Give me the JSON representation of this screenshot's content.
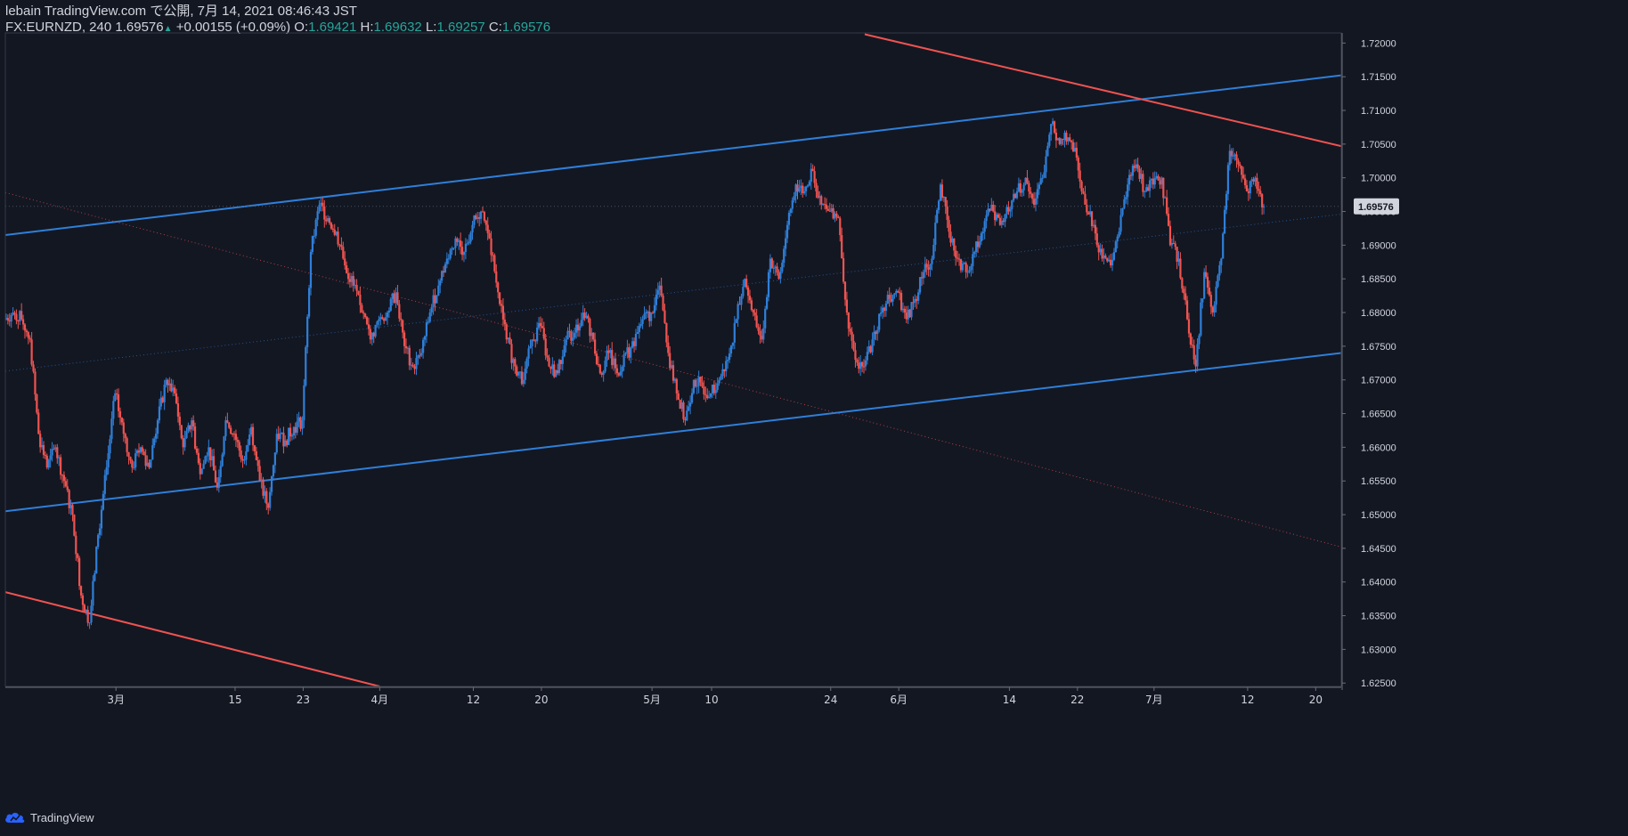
{
  "header": {
    "line1": "lebain TradingView.com で公開, 7月 14, 2021 08:46:43 JST",
    "symbol": "FX:EURNZD, 240",
    "last": "1.69576",
    "change": "+0.00155 (+0.09%)",
    "o_label": "O:",
    "o_value": "1.69421",
    "h_label": "H:",
    "h_value": "1.69632",
    "l_label": "L:",
    "l_value": "1.69257",
    "c_label": "C:",
    "c_value": "1.69576"
  },
  "footer": {
    "brand": "TradingView",
    "logo_icon": "tradingview-cloud-icon"
  },
  "colors": {
    "background": "#131722",
    "up": "#2f7fd8",
    "down": "#ef5350",
    "channel": "#2f7fd8",
    "trend": "#ef5350",
    "axis_text": "#d1d4dc",
    "price_label_bg": "#d1d4dc"
  },
  "chart_data": {
    "type": "candlestick",
    "ylim": [
      1.6245,
      1.7215
    ],
    "y_ticks": [
      "1.72000",
      "1.71500",
      "1.71000",
      "1.70500",
      "1.70000",
      "1.69500",
      "1.69000",
      "1.68500",
      "1.68000",
      "1.67500",
      "1.67000",
      "1.66500",
      "1.66000",
      "1.65500",
      "1.65000",
      "1.64500",
      "1.64000",
      "1.63500",
      "1.63000",
      "1.62500"
    ],
    "x_ticks": [
      {
        "label": "3月",
        "date": "2021-03-01"
      },
      {
        "label": "15",
        "date": "2021-03-15"
      },
      {
        "label": "23",
        "date": "2021-03-23"
      },
      {
        "label": "4月",
        "date": "2021-04-01"
      },
      {
        "label": "12",
        "date": "2021-04-12"
      },
      {
        "label": "20",
        "date": "2021-04-20"
      },
      {
        "label": "5月",
        "date": "2021-05-03"
      },
      {
        "label": "10",
        "date": "2021-05-10"
      },
      {
        "label": "24",
        "date": "2021-05-24"
      },
      {
        "label": "6月",
        "date": "2021-06-01"
      },
      {
        "label": "14",
        "date": "2021-06-14"
      },
      {
        "label": "22",
        "date": "2021-06-22"
      },
      {
        "label": "7月",
        "date": "2021-07-01"
      },
      {
        "label": "12",
        "date": "2021-07-12"
      },
      {
        "label": "20",
        "date": "2021-07-20"
      }
    ],
    "last_price_label": "1.69576",
    "last_price": 1.69576,
    "path_waypoints": [
      [
        "2021-02-16",
        1.679
      ],
      [
        "2021-02-17",
        1.68
      ],
      [
        "2021-02-18",
        1.679
      ],
      [
        "2021-02-19",
        1.676
      ],
      [
        "2021-02-20",
        1.662
      ],
      [
        "2021-02-21",
        1.657
      ],
      [
        "2021-02-22",
        1.66
      ],
      [
        "2021-02-23",
        1.655
      ],
      [
        "2021-02-24",
        1.65
      ],
      [
        "2021-02-25",
        1.638
      ],
      [
        "2021-02-26",
        1.634
      ],
      [
        "2021-02-27",
        1.647
      ],
      [
        "2021-02-28",
        1.657
      ],
      [
        "2021-03-01",
        1.668
      ],
      [
        "2021-03-02",
        1.662
      ],
      [
        "2021-03-03",
        1.657
      ],
      [
        "2021-03-04",
        1.66
      ],
      [
        "2021-03-05",
        1.657
      ],
      [
        "2021-03-06",
        1.664
      ],
      [
        "2021-03-07",
        1.67
      ],
      [
        "2021-03-08",
        1.668
      ],
      [
        "2021-03-09",
        1.66
      ],
      [
        "2021-03-10",
        1.664
      ],
      [
        "2021-03-11",
        1.656
      ],
      [
        "2021-03-12",
        1.66
      ],
      [
        "2021-03-13",
        1.654
      ],
      [
        "2021-03-14",
        1.664
      ],
      [
        "2021-03-15",
        1.662
      ],
      [
        "2021-03-16",
        1.658
      ],
      [
        "2021-03-17",
        1.663
      ],
      [
        "2021-03-18",
        1.655
      ],
      [
        "2021-03-19",
        1.651
      ],
      [
        "2021-03-20",
        1.662
      ],
      [
        "2021-03-21",
        1.661
      ],
      [
        "2021-03-22",
        1.663
      ],
      [
        "2021-03-23",
        1.664
      ],
      [
        "2021-03-24",
        1.689
      ],
      [
        "2021-03-25",
        1.696
      ],
      [
        "2021-03-26",
        1.694
      ],
      [
        "2021-03-27",
        1.692
      ],
      [
        "2021-03-28",
        1.687
      ],
      [
        "2021-03-29",
        1.684
      ],
      [
        "2021-03-30",
        1.68
      ],
      [
        "2021-03-31",
        1.676
      ],
      [
        "2021-04-01",
        1.679
      ],
      [
        "2021-04-02",
        1.68
      ],
      [
        "2021-04-03",
        1.683
      ],
      [
        "2021-04-04",
        1.675
      ],
      [
        "2021-04-05",
        1.672
      ],
      [
        "2021-04-06",
        1.674
      ],
      [
        "2021-04-07",
        1.68
      ],
      [
        "2021-04-08",
        1.684
      ],
      [
        "2021-04-09",
        1.688
      ],
      [
        "2021-04-10",
        1.691
      ],
      [
        "2021-04-11",
        1.689
      ],
      [
        "2021-04-12",
        1.693
      ],
      [
        "2021-04-13",
        1.695
      ],
      [
        "2021-04-14",
        1.691
      ],
      [
        "2021-04-15",
        1.683
      ],
      [
        "2021-04-16",
        1.676
      ],
      [
        "2021-04-17",
        1.672
      ],
      [
        "2021-04-18",
        1.67
      ],
      [
        "2021-04-19",
        1.676
      ],
      [
        "2021-04-20",
        1.678
      ],
      [
        "2021-04-21",
        1.672
      ],
      [
        "2021-04-22",
        1.671
      ],
      [
        "2021-04-23",
        1.676
      ],
      [
        "2021-04-24",
        1.677
      ],
      [
        "2021-04-25",
        1.68
      ],
      [
        "2021-04-26",
        1.677
      ],
      [
        "2021-04-27",
        1.671
      ],
      [
        "2021-04-28",
        1.674
      ],
      [
        "2021-04-29",
        1.671
      ],
      [
        "2021-04-30",
        1.674
      ],
      [
        "2021-05-01",
        1.675
      ],
      [
        "2021-05-02",
        1.679
      ],
      [
        "2021-05-03",
        1.68
      ],
      [
        "2021-05-04",
        1.684
      ],
      [
        "2021-05-05",
        1.674
      ],
      [
        "2021-05-06",
        1.668
      ],
      [
        "2021-05-07",
        1.664
      ],
      [
        "2021-05-08",
        1.67
      ],
      [
        "2021-05-09",
        1.669
      ],
      [
        "2021-05-10",
        1.668
      ],
      [
        "2021-05-11",
        1.67
      ],
      [
        "2021-05-12",
        1.673
      ],
      [
        "2021-05-13",
        1.679
      ],
      [
        "2021-05-14",
        1.685
      ],
      [
        "2021-05-15",
        1.68
      ],
      [
        "2021-05-16",
        1.676
      ],
      [
        "2021-05-17",
        1.688
      ],
      [
        "2021-05-18",
        1.685
      ],
      [
        "2021-05-19",
        1.693
      ],
      [
        "2021-05-20",
        1.699
      ],
      [
        "2021-05-21",
        1.698
      ],
      [
        "2021-05-22",
        1.701
      ],
      [
        "2021-05-23",
        1.696
      ],
      [
        "2021-05-24",
        1.695
      ],
      [
        "2021-05-25",
        1.694
      ],
      [
        "2021-05-26",
        1.68
      ],
      [
        "2021-05-27",
        1.673
      ],
      [
        "2021-05-28",
        1.672
      ],
      [
        "2021-05-29",
        1.676
      ],
      [
        "2021-05-30",
        1.68
      ],
      [
        "2021-05-31",
        1.682
      ],
      [
        "2021-06-01",
        1.683
      ],
      [
        "2021-06-02",
        1.679
      ],
      [
        "2021-06-03",
        1.682
      ],
      [
        "2021-06-04",
        1.686
      ],
      [
        "2021-06-05",
        1.688
      ],
      [
        "2021-06-06",
        1.699
      ],
      [
        "2021-06-07",
        1.692
      ],
      [
        "2021-06-08",
        1.688
      ],
      [
        "2021-06-09",
        1.686
      ],
      [
        "2021-06-10",
        1.689
      ],
      [
        "2021-06-11",
        1.692
      ],
      [
        "2021-06-12",
        1.696
      ],
      [
        "2021-06-13",
        1.693
      ],
      [
        "2021-06-14",
        1.695
      ],
      [
        "2021-06-15",
        1.698
      ],
      [
        "2021-06-16",
        1.7
      ],
      [
        "2021-06-17",
        1.696
      ],
      [
        "2021-06-18",
        1.7
      ],
      [
        "2021-06-19",
        1.708
      ],
      [
        "2021-06-20",
        1.705
      ],
      [
        "2021-06-21",
        1.706
      ],
      [
        "2021-06-22",
        1.703
      ],
      [
        "2021-06-23",
        1.696
      ],
      [
        "2021-06-24",
        1.693
      ],
      [
        "2021-06-25",
        1.688
      ],
      [
        "2021-06-26",
        1.687
      ],
      [
        "2021-06-27",
        1.692
      ],
      [
        "2021-06-28",
        1.699
      ],
      [
        "2021-06-29",
        1.702
      ],
      [
        "2021-06-30",
        1.698
      ],
      [
        "2021-07-01",
        1.699
      ],
      [
        "2021-07-02",
        1.7
      ],
      [
        "2021-07-03",
        1.69
      ],
      [
        "2021-07-04",
        1.688
      ],
      [
        "2021-07-05",
        1.679
      ],
      [
        "2021-07-06",
        1.672
      ],
      [
        "2021-07-07",
        1.686
      ],
      [
        "2021-07-08",
        1.68
      ],
      [
        "2021-07-09",
        1.688
      ],
      [
        "2021-07-10",
        1.704
      ],
      [
        "2021-07-11",
        1.702
      ],
      [
        "2021-07-12",
        1.698
      ],
      [
        "2021-07-13",
        1.7
      ],
      [
        "2021-07-14",
        1.69576
      ]
    ],
    "drawings": [
      {
        "kind": "channel-upper",
        "from": [
          "2021-02-16",
          1.6915
        ],
        "to": [
          "2021-07-23",
          1.7152
        ]
      },
      {
        "kind": "channel-lower",
        "from": [
          "2021-02-16",
          1.6505
        ],
        "to": [
          "2021-07-23",
          1.674
        ]
      },
      {
        "kind": "channel-mid",
        "from": [
          "2021-02-16",
          1.6713
        ],
        "to": [
          "2021-07-23",
          1.6946
        ]
      },
      {
        "kind": "trend-upper",
        "from": [
          "2021-05-28",
          1.7213
        ],
        "to": [
          "2021-07-23",
          1.7047
        ]
      },
      {
        "kind": "trend-lower",
        "from": [
          "2021-02-16",
          1.6385
        ],
        "to": [
          "2021-04-01",
          1.6245
        ]
      },
      {
        "kind": "trend-dotted",
        "from": [
          "2021-02-16",
          1.6978
        ],
        "to": [
          "2021-07-23",
          1.6452
        ]
      }
    ]
  }
}
